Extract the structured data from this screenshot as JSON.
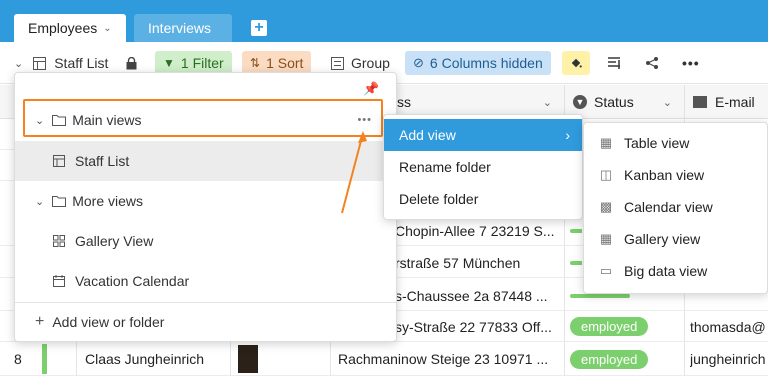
{
  "tabs": {
    "active": "Employees",
    "inactive": "Interviews"
  },
  "toolbar": {
    "view_name": "Staff List",
    "filter": "1 Filter",
    "sort": "1 Sort",
    "group": "Group",
    "hidden": "6 Columns hidden"
  },
  "columns": {
    "address": "ss",
    "status": "Status",
    "email": "E-mail"
  },
  "rows": [
    {
      "address": "Chopin-Allee 7 23219 S...",
      "status": "",
      "email": ""
    },
    {
      "address": "rstraße 57 München",
      "status": "",
      "email": ""
    },
    {
      "address": "s-Chaussee 2a 87448 ...",
      "status": "",
      "email": ""
    },
    {
      "address": "sy-Straße 22 77833 Off...",
      "status": "employed",
      "email": "thomasda@"
    },
    {
      "num": "8",
      "name": "Claas Jungheinrich",
      "address": "Rachmaninow Steige 23 10971 ...",
      "status": "employed",
      "email": "jungheinrich"
    }
  ],
  "panel": {
    "main_views": "Main views",
    "staff_list": "Staff List",
    "more_views": "More views",
    "gallery_view": "Gallery View",
    "vacation_calendar": "Vacation Calendar",
    "add": "Add view or folder"
  },
  "context_menu": {
    "add_view": "Add view",
    "rename": "Rename folder",
    "delete": "Delete folder"
  },
  "submenu": {
    "table": "Table view",
    "kanban": "Kanban view",
    "calendar": "Calendar view",
    "gallery": "Gallery view",
    "bigdata": "Big data view"
  },
  "colors": {
    "accent": "#2f9bdd",
    "highlight": "#f5821f",
    "employed": "#7ccf6d"
  }
}
